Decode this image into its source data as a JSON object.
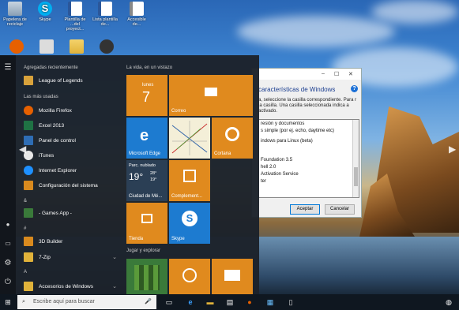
{
  "desktop": {
    "icons": [
      {
        "label": "Papelera de reciclaje",
        "icon": "recycle-bin-icon"
      },
      {
        "label": "Skype",
        "icon": "skype-icon"
      },
      {
        "label": "Plantilla de ...del proyect...",
        "icon": "word-document-icon"
      },
      {
        "label": "Lista plantilla de...",
        "icon": "word-document-icon"
      },
      {
        "label": "Accesible de...",
        "icon": "document-icon"
      }
    ]
  },
  "start_menu": {
    "recent_header": "Agregadas recientemente",
    "recent": [
      {
        "label": "League of Legends",
        "color": "#d8a23b"
      }
    ],
    "most_used_header": "Las más usadas",
    "most_used": [
      {
        "label": "Mozilla Firefox",
        "color": "#e66000"
      },
      {
        "label": "Excel 2013",
        "color": "#1f7244"
      },
      {
        "label": "Panel de control",
        "color": "#2e6db4"
      },
      {
        "label": "iTunes",
        "color": "#e8e8e8"
      },
      {
        "label": "Internet Explorer",
        "color": "#1e90ff"
      },
      {
        "label": "Configuración del sistema",
        "color": "#d98a1e"
      }
    ],
    "ampersand_header": "&",
    "games_app": "- Games App -",
    "number_header": "#",
    "builder": "3D Builder",
    "zip": "7-Zip",
    "a_header": "A",
    "accesorios": "Accesorios de Windows",
    "tiles_header": "La vida, en un vistazo",
    "play_header": "Jugar y explorar",
    "tiles": {
      "calendar_day": "lunes",
      "calendar_date": "7",
      "mail": "Correo",
      "edge": "Microsoft Edge",
      "cortana": "Cortana",
      "weather_cond": "Parc. nublado",
      "weather_temp": "19°",
      "weather_high": "28°",
      "weather_low": "19°",
      "weather_city": "Ciudad de Mé...",
      "complement": "Complement...",
      "store": "Tienda",
      "skype": "Skype"
    }
  },
  "dialog": {
    "title": "características de Windows",
    "description": "a, seleccione la casilla correspondiente. Para r la casilla. Una casilla seleccionada indica a activado.",
    "items": [
      "resión y documentos",
      "s simple (por ej. echo, daytime etc)",
      "indows para Linux (beta)",
      "Foundation 3.5",
      "hell 2.0",
      "Activation Service",
      "ter"
    ],
    "accept": "Aceptar",
    "cancel": "Cancelar"
  },
  "taskbar": {
    "search_placeholder": "Escribe aquí para buscar"
  }
}
